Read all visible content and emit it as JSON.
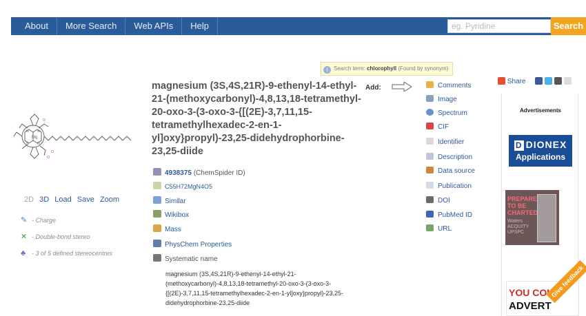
{
  "nav": {
    "items": [
      "About",
      "More Search",
      "Web APIs",
      "Help"
    ],
    "search_placeholder": "eg. Pyridine",
    "search_button": "Search"
  },
  "search_hint": {
    "prefix": "Search term:",
    "term": "chlorophyll",
    "suffix": "(Found by synonym)"
  },
  "compound": {
    "title": "magnesium (3S,4S,21R)-9-ethenyl-14-ethyl-21-(methoxycarbonyl)-4,8,13,18-tetramethyl-20-oxo-3-(3-oxo-3-{[(2E)-3,7,11,15-tetramethylhexadec-2-en-1-yl]oxy}propyl)-23,25-didehydrophorbine-23,25-diide",
    "chemspider_id": "4938375",
    "chemspider_id_label": "(ChemSpider ID)",
    "formula": "C55H72MgN4O5",
    "links": [
      "Similar",
      "Wikibox",
      "Mass",
      "PhysChem Properties",
      "Systematic name"
    ],
    "systematic_name": "magnesium (3S,4S,21R)-9-ethenyl-14-ethyl-21-(methoxycarbonyl)-4,8,13,18-tetramethyl-20-oxo-3-(3-oxo-3-{[(2E)-3,7,11,15-tetramethylhexadec-2-en-1-yl]oxy}propyl)-23,25-didehydrophorbine-23,25-diide"
  },
  "viewer": {
    "controls": [
      "2D",
      "3D",
      "Load",
      "Save",
      "Zoom"
    ],
    "stereo_notes": [
      "- Charge",
      "- Double-bond stereo",
      "- 3 of 5 defined stereocentres"
    ]
  },
  "add_panel": {
    "label": "Add:",
    "items": [
      "Comments",
      "Image",
      "Spectrum",
      "CIF",
      "Identifier",
      "Description",
      "Data source",
      "Publication",
      "DOI",
      "PubMed ID",
      "URL"
    ]
  },
  "share": {
    "label": "Share"
  },
  "ads": {
    "title": "Advertisements",
    "dionex_logo": "DIONEX",
    "dionex_sub": "Applications",
    "waters_headline": "PREPARE TO BE CHARTED",
    "waters_sub": "Waters ACQUITY UPSPC",
    "yc_line1": "YOU COU",
    "yc_line2": "ADVERT"
  },
  "feedback": "Give feedback",
  "colors": {
    "nav_bg": "#2a5b9a",
    "search_btn": "#f2a51e",
    "link": "#2a5b9a"
  }
}
